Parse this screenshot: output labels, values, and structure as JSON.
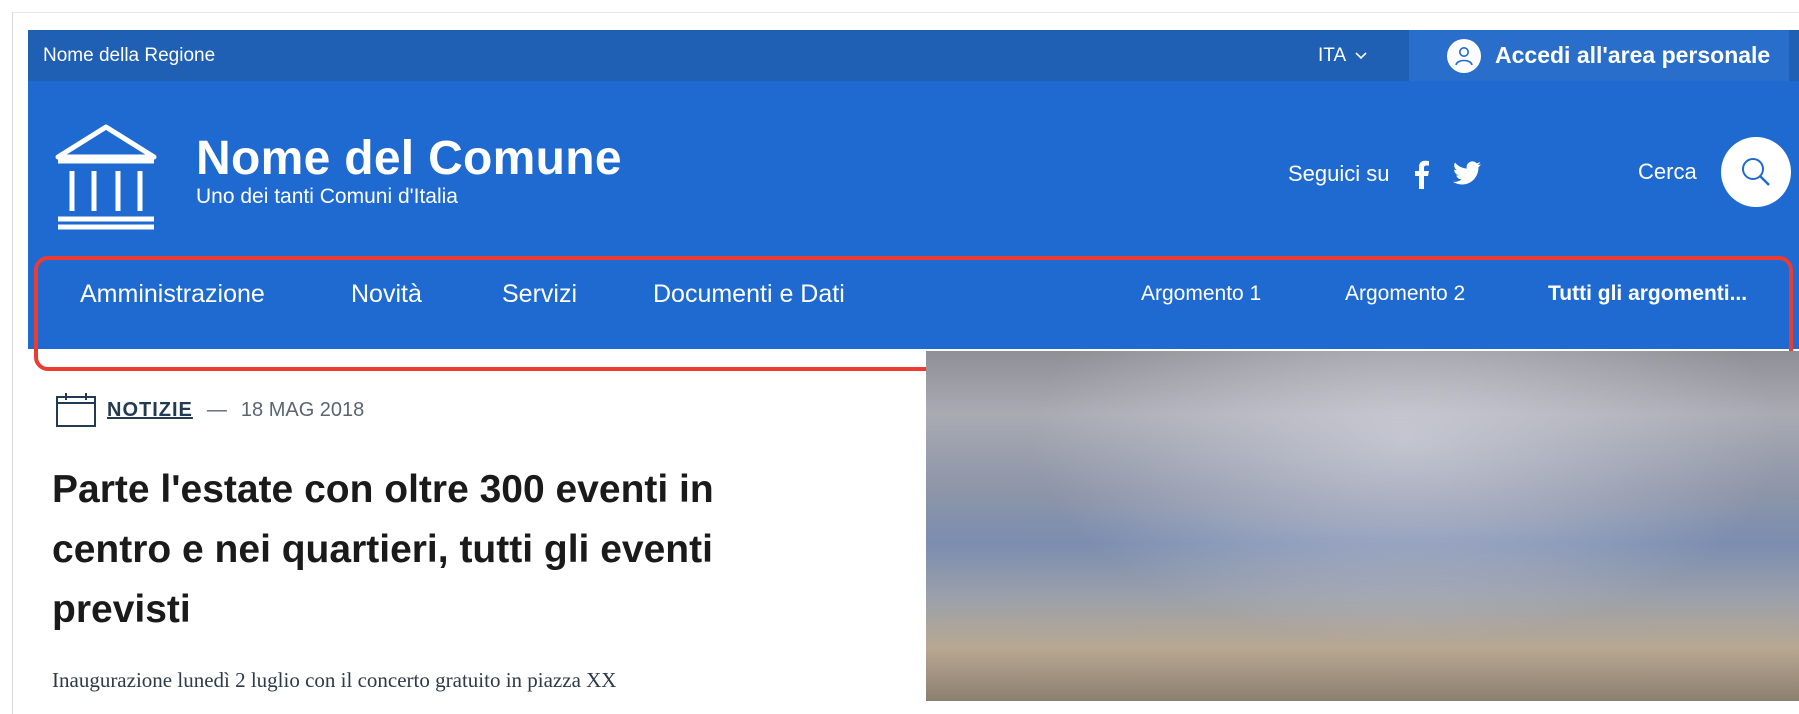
{
  "topbar": {
    "region": "Nome della Regione",
    "language": "ITA",
    "login_label": "Accedi all'area personale"
  },
  "header": {
    "name": "Nome del Comune",
    "subtitle": "Uno dei tanti Comuni d'Italia",
    "follow_label": "Seguici su",
    "search_label": "Cerca"
  },
  "nav": {
    "items": [
      "Amministrazione",
      "Novità",
      "Servizi",
      "Documenti e Dati"
    ],
    "topics": [
      "Argomento 1",
      "Argomento 2"
    ],
    "all_topics": "Tutti gli argomenti..."
  },
  "article": {
    "category": "NOTIZIE",
    "separator": "—",
    "date": "18 MAG 2018",
    "title": "Parte l'estate con oltre 300 eventi in centro e nei quartieri, tutti gli eventi previsti",
    "lead": "Inaugurazione lunedì 2 luglio con il concerto gratuito in piazza XX"
  },
  "colors": {
    "brand_blue": "#1f6ad1",
    "topbar_blue": "#1f5fb4",
    "highlight_red": "#ec3b30"
  },
  "icons": [
    "municipality-icon",
    "facebook-icon",
    "twitter-icon",
    "search-icon",
    "user-icon",
    "chevron-down-icon",
    "calendar-icon"
  ]
}
